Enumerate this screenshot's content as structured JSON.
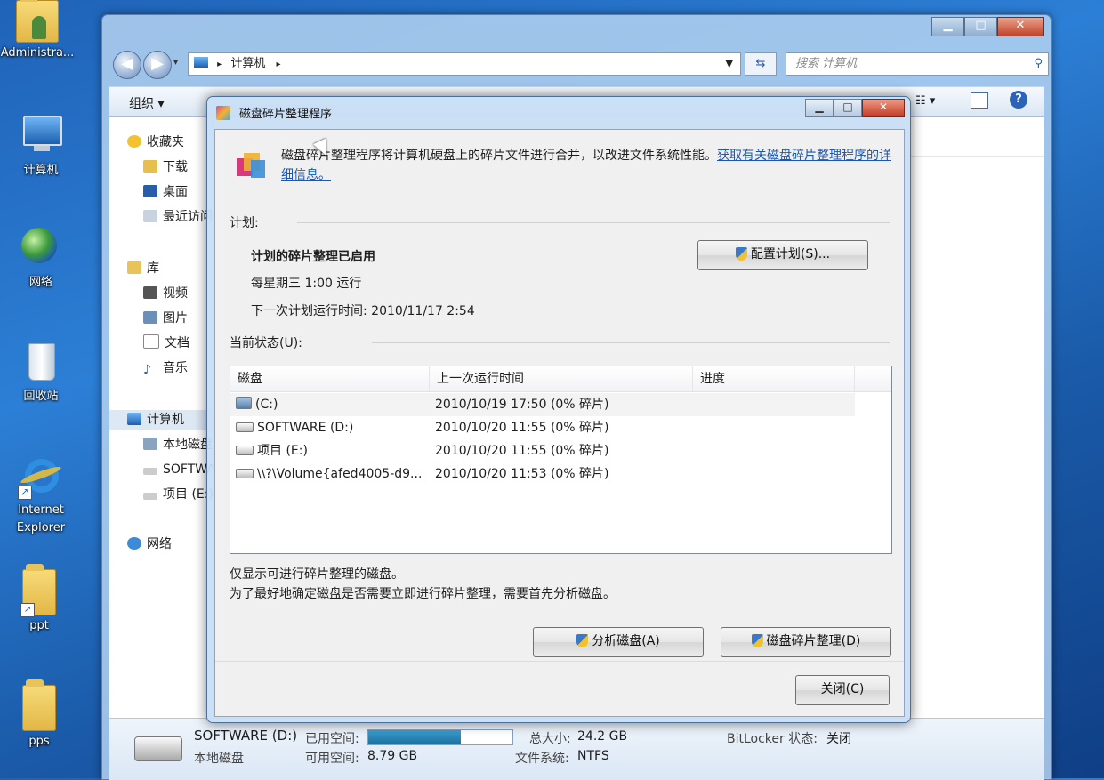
{
  "desktop": {
    "icons": [
      {
        "label": "Administra..."
      },
      {
        "label": "计算机"
      },
      {
        "label": "网络"
      },
      {
        "label": "回收站"
      },
      {
        "label": "Internet Explorer"
      },
      {
        "label": "ppt"
      },
      {
        "label": "pps"
      }
    ]
  },
  "explorer": {
    "address": "计算机",
    "search_placeholder": "搜索 计算机",
    "toolbar": {
      "organize": "组织 ▾"
    },
    "nav": {
      "favorites": "收藏夹",
      "downloads": "下载",
      "desktop": "桌面",
      "recent": "最近访问的位置",
      "libraries": "库",
      "videos": "视频",
      "pictures": "图片",
      "documents": "文档",
      "music": "音乐",
      "computer": "计算机",
      "local_disk": "本地磁盘 (C:)",
      "software": "SOFTWARE (D:)",
      "project": "项目 (E:)",
      "network": "网络"
    },
    "details": {
      "drive_name": "SOFTWARE (D:)",
      "drive_type": "本地磁盘",
      "used_label": "已用空间:",
      "free_label": "可用空间:",
      "free_value": "8.79 GB",
      "total_label": "总大小:",
      "total_value": "24.2 GB",
      "fs_label": "文件系统:",
      "fs_value": "NTFS",
      "bitlocker_label": "BitLocker 状态:",
      "bitlocker_value": "关闭",
      "used_fraction": 0.64
    }
  },
  "dialog": {
    "title": "磁盘碎片整理程序",
    "intro": "磁盘碎片整理程序将计算机硬盘上的碎片文件进行合并，以改进文件系统性能。",
    "intro_link": "获取有关磁盘碎片整理程序的详细信息。",
    "schedule_header": "计划:",
    "schedule_status": "计划的碎片整理已启用",
    "schedule_time": "每星期三  1:00 运行",
    "next_run": "下一次计划运行时间: 2010/11/17 2:54",
    "config_button": "配置计划(S)...",
    "status_header": "当前状态(U):",
    "columns": [
      "磁盘",
      "上一次运行时间",
      "进度"
    ],
    "rows": [
      {
        "disk": "(C:)",
        "last": "2010/10/19 17:50 (0% 碎片)"
      },
      {
        "disk": "SOFTWARE (D:)",
        "last": "2010/10/20 11:55 (0% 碎片)"
      },
      {
        "disk": "项目 (E:)",
        "last": "2010/10/20 11:55 (0% 碎片)"
      },
      {
        "disk": "\\\\?\\Volume{afed4005-d9...",
        "last": "2010/10/20 11:53 (0% 碎片)"
      }
    ],
    "note1": "仅显示可进行碎片整理的磁盘。",
    "note2": "为了最好地确定磁盘是否需要立即进行碎片整理，需要首先分析磁盘。",
    "analyze_button": "分析磁盘(A)",
    "defrag_button": "磁盘碎片整理(D)",
    "close_button": "关闭(C)"
  }
}
